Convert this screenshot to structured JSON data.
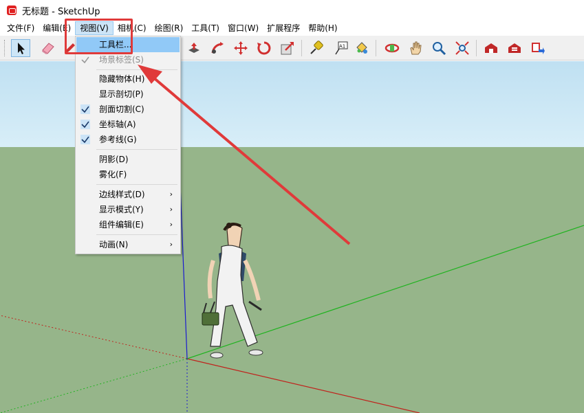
{
  "window": {
    "title": "无标题 - SketchUp"
  },
  "menubar": {
    "items": [
      {
        "label": "文件(F)"
      },
      {
        "label": "编辑(E)"
      },
      {
        "label": "视图(V)"
      },
      {
        "label": "相机(C)"
      },
      {
        "label": "绘图(R)"
      },
      {
        "label": "工具(T)"
      },
      {
        "label": "窗口(W)"
      },
      {
        "label": "扩展程序"
      },
      {
        "label": "帮助(H)"
      }
    ],
    "active_index": 2
  },
  "toolbar": {
    "tools": [
      {
        "icon": "select-arrow-icon"
      },
      {
        "icon": "eraser-icon"
      },
      {
        "icon": "pencil-icon"
      },
      {
        "icon": "push-pull-icon"
      },
      {
        "icon": "follow-me-icon"
      },
      {
        "icon": "move-icon"
      },
      {
        "icon": "rotate-icon"
      },
      {
        "icon": "scale-icon"
      },
      {
        "icon": "tape-measure-icon"
      },
      {
        "icon": "text-icon",
        "glyph": "A1"
      },
      {
        "icon": "paint-bucket-icon"
      },
      {
        "icon": "orbit-icon"
      },
      {
        "icon": "pan-hand-icon"
      },
      {
        "icon": "zoom-icon"
      },
      {
        "icon": "zoom-extents-icon"
      },
      {
        "icon": "warehouse-icon"
      },
      {
        "icon": "extension-warehouse-icon"
      },
      {
        "icon": "send-to-layout-icon"
      }
    ],
    "selected_index": 0
  },
  "view_menu": {
    "items": [
      {
        "label": "工具栏...",
        "state": "highlight",
        "check": false,
        "submenu": false
      },
      {
        "label": "场景标签(S)",
        "state": "disabled",
        "check": true,
        "submenu": false
      },
      {
        "label": "隐藏物体(H)",
        "state": "normal",
        "check": false,
        "submenu": false
      },
      {
        "label": "显示剖切(P)",
        "state": "normal",
        "check": false,
        "submenu": false
      },
      {
        "label": "剖面切割(C)",
        "state": "normal",
        "check": true,
        "submenu": false
      },
      {
        "label": "坐标轴(A)",
        "state": "normal",
        "check": true,
        "submenu": false
      },
      {
        "label": "参考线(G)",
        "state": "normal",
        "check": true,
        "submenu": false
      },
      {
        "label": "阴影(D)",
        "state": "normal",
        "check": false,
        "submenu": false
      },
      {
        "label": "雾化(F)",
        "state": "normal",
        "check": false,
        "submenu": false
      },
      {
        "label": "边线样式(D)",
        "state": "normal",
        "check": false,
        "submenu": true
      },
      {
        "label": "显示模式(Y)",
        "state": "normal",
        "check": false,
        "submenu": true
      },
      {
        "label": "组件编辑(E)",
        "state": "normal",
        "check": false,
        "submenu": true
      },
      {
        "label": "动画(N)",
        "state": "normal",
        "check": false,
        "submenu": true
      }
    ]
  },
  "colors": {
    "sky_top": "#bfe0f2",
    "ground": "#96b58a",
    "axis_red": "#c0221c",
    "axis_green": "#1fb31f",
    "axis_blue": "#1a1ad0",
    "annotation_red": "#e03a3a",
    "menu_highlight": "#91c9f7"
  }
}
